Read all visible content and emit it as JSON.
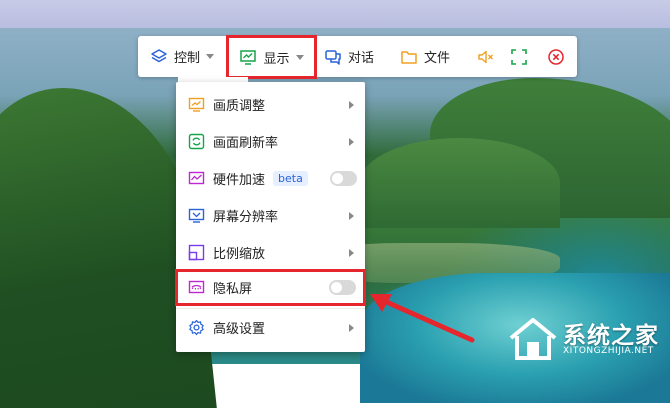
{
  "toolbar": {
    "control_label": "控制",
    "display_label": "显示",
    "chat_label": "对话",
    "file_label": "文件"
  },
  "menu": {
    "items": [
      {
        "label": "画质调整",
        "icon": "picture-quality-icon",
        "trailing": "arrow"
      },
      {
        "label": "画面刷新率",
        "icon": "refresh-rate-icon",
        "trailing": "arrow"
      },
      {
        "label": "硬件加速",
        "icon": "hardware-acceleration-icon",
        "badge": "beta",
        "trailing": "toggle",
        "on": false
      },
      {
        "label": "屏幕分辨率",
        "icon": "screen-resolution-icon",
        "trailing": "arrow"
      },
      {
        "label": "比例缩放",
        "icon": "scale-icon",
        "trailing": "arrow"
      },
      {
        "label": "隐私屏",
        "icon": "privacy-screen-icon",
        "trailing": "toggle",
        "on": false
      },
      {
        "label": "高级设置",
        "icon": "advanced-settings-icon",
        "trailing": "arrow"
      }
    ]
  },
  "watermark": {
    "main": "系统之家",
    "sub": "XITONGZHIJIA.NET"
  },
  "colors": {
    "highlight": "#e5262d",
    "accent_blue": "#2962d9",
    "icon_orange": "#f0a020",
    "icon_green": "#16a34a",
    "icon_purple": "#c026d3"
  }
}
